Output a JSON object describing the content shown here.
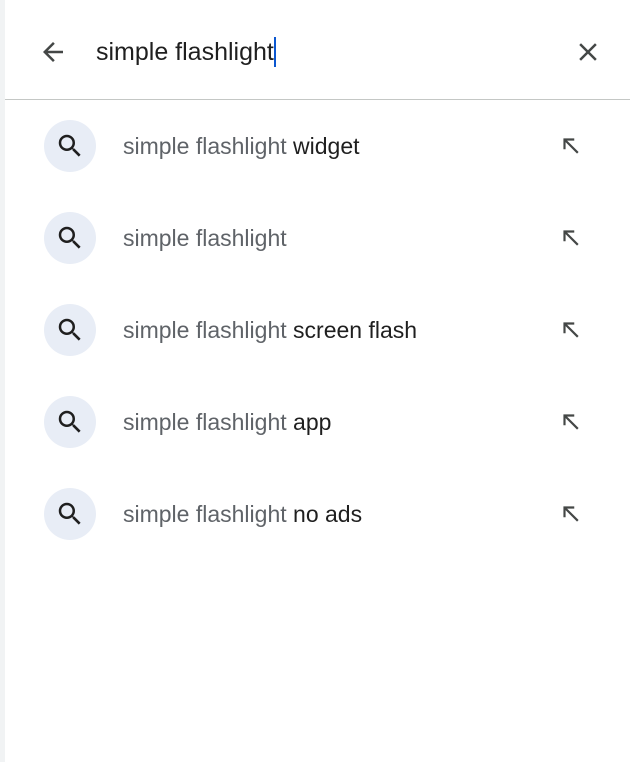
{
  "search": {
    "query": "simple flashlight",
    "back_icon": "arrow-back-icon",
    "clear_icon": "close-icon"
  },
  "suggestions": [
    {
      "prefix": "simple flashlight",
      "suffix": " widget"
    },
    {
      "prefix": "simple flashlight",
      "suffix": ""
    },
    {
      "prefix": "simple flashlight",
      "suffix": " screen flash"
    },
    {
      "prefix": "simple flashlight",
      "suffix": " app"
    },
    {
      "prefix": "simple flashlight",
      "suffix": " no ads"
    }
  ],
  "suggestion_icons": {
    "search": "search-icon",
    "fill": "arrow-up-left-icon"
  },
  "colors": {
    "caret": "#0b57d0",
    "icon_bubble": "#e8edf6",
    "text_primary": "#1f1f1f",
    "text_secondary": "#5f6368"
  }
}
